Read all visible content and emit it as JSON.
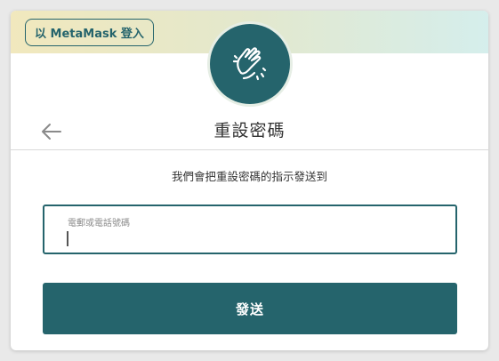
{
  "header": {
    "metamask_button_label": "以 MetaMask 登入"
  },
  "avatar": {
    "icon": "clapping-hands-icon",
    "colors": {
      "fill": "#25646c",
      "ring": "#e6eee5"
    }
  },
  "back": {
    "icon": "arrow-left-icon"
  },
  "title": "重設密碼",
  "instruction": "我們會把重設密碼的指示發送到",
  "form": {
    "field_label": "電郵或電話號碼",
    "field_value": ""
  },
  "send_button_label": "發送",
  "colors": {
    "accent": "#25646c",
    "banner_left": "#f1e8bd",
    "banner_right": "#d5eeec"
  }
}
